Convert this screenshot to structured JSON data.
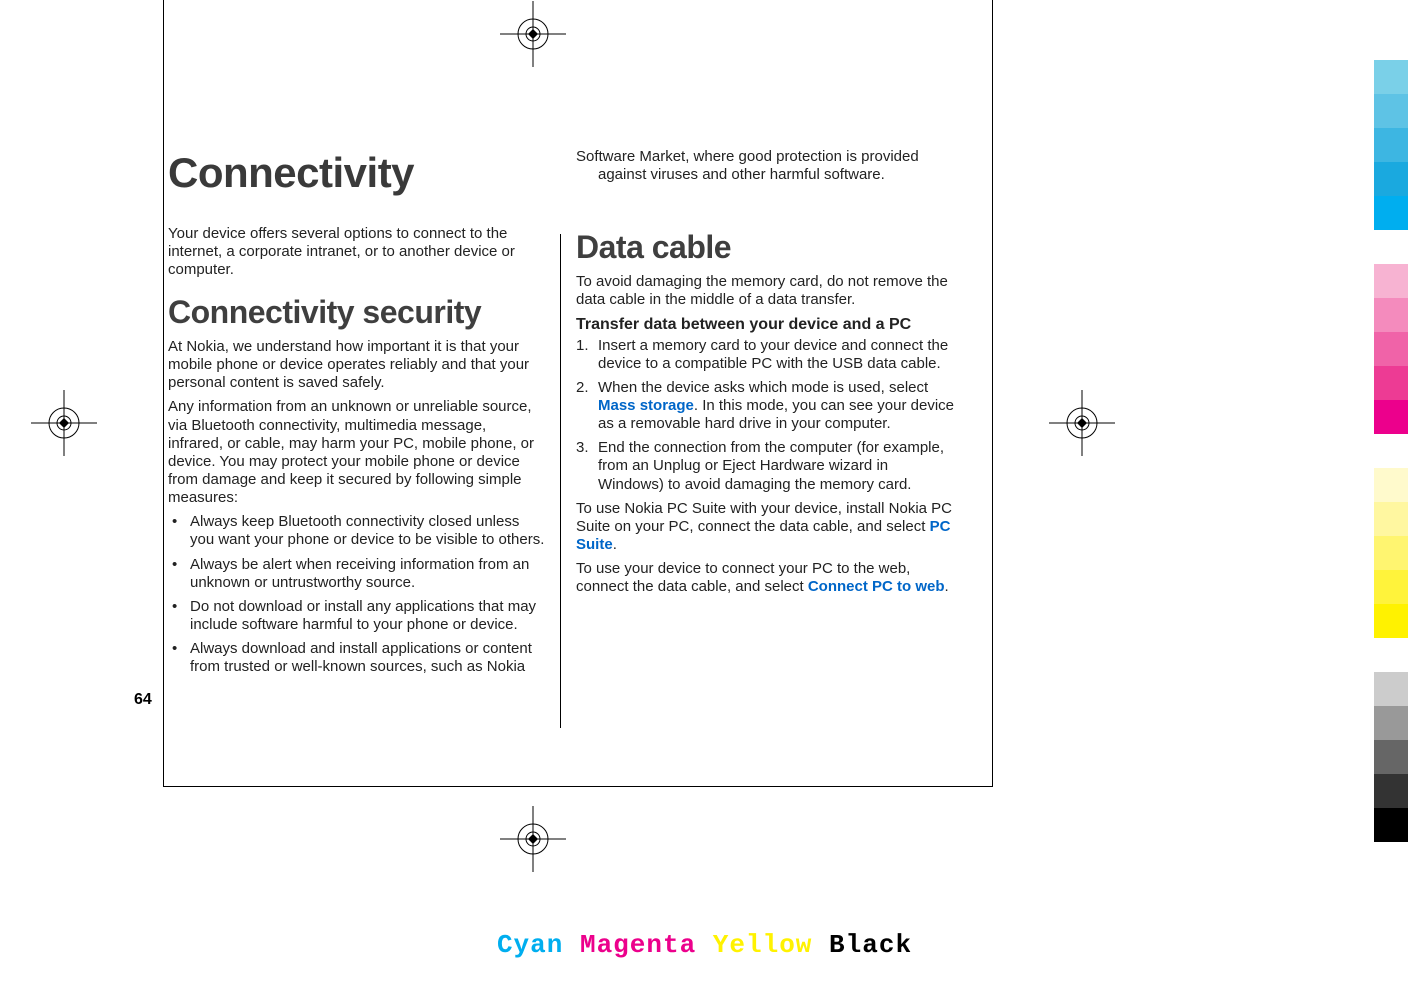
{
  "page_number": "64",
  "cmyk": {
    "c": "Cyan",
    "m": "Magenta",
    "y": "Yellow",
    "k": "Black"
  },
  "left": {
    "h0": "Connectivity",
    "intro": "Your device offers several options to connect to the internet, a corporate intranet, or to another device or computer.",
    "h1": "Connectivity security",
    "p1": "At Nokia, we understand how important it is that your mobile phone or device operates reliably and that your personal content is saved safely.",
    "p2": "Any information from an unknown or unreliable source, via Bluetooth connectivity, multimedia message, infrared, or cable, may harm your PC, mobile phone, or device. You may protect your mobile phone or device from damage and keep it secured by following simple measures:",
    "b1": "Always keep Bluetooth connectivity closed unless you want your phone or device to be visible to others.",
    "b2": "Always be alert when receiving information from an unknown or untrustworthy source.",
    "b3": "Do not download or install any applications that may include software harmful to your phone or device.",
    "b4": "Always download and install applications or content from trusted or well-known sources, such as Nokia"
  },
  "right": {
    "cont": "Software Market, where good protection is provided against viruses and other harmful software.",
    "h1": "Data cable",
    "p1": "To avoid damaging the memory card, do not remove the data cable in the middle of a data transfer.",
    "h2": "Transfer data between your device and a PC",
    "s1": "Insert a memory card to your device and connect the device to a compatible PC with the USB data cable.",
    "s2a": "When the device asks which mode is used, select ",
    "s2_blue": "Mass storage",
    "s2b": ". In this mode, you can see your device as a removable hard drive in your computer.",
    "s3": "End the connection from the computer (for example, from an Unplug or Eject Hardware wizard in Windows) to avoid damaging the memory card.",
    "p2a": "To use Nokia PC Suite with your device, install Nokia PC Suite on your PC, connect the data cable, and select ",
    "p2_blue": "PC Suite",
    "p2b": ".",
    "p3a": "To use your device to connect your PC to the web, connect the data cable, and select ",
    "p3_blue": "Connect PC to web",
    "p3b": "."
  }
}
